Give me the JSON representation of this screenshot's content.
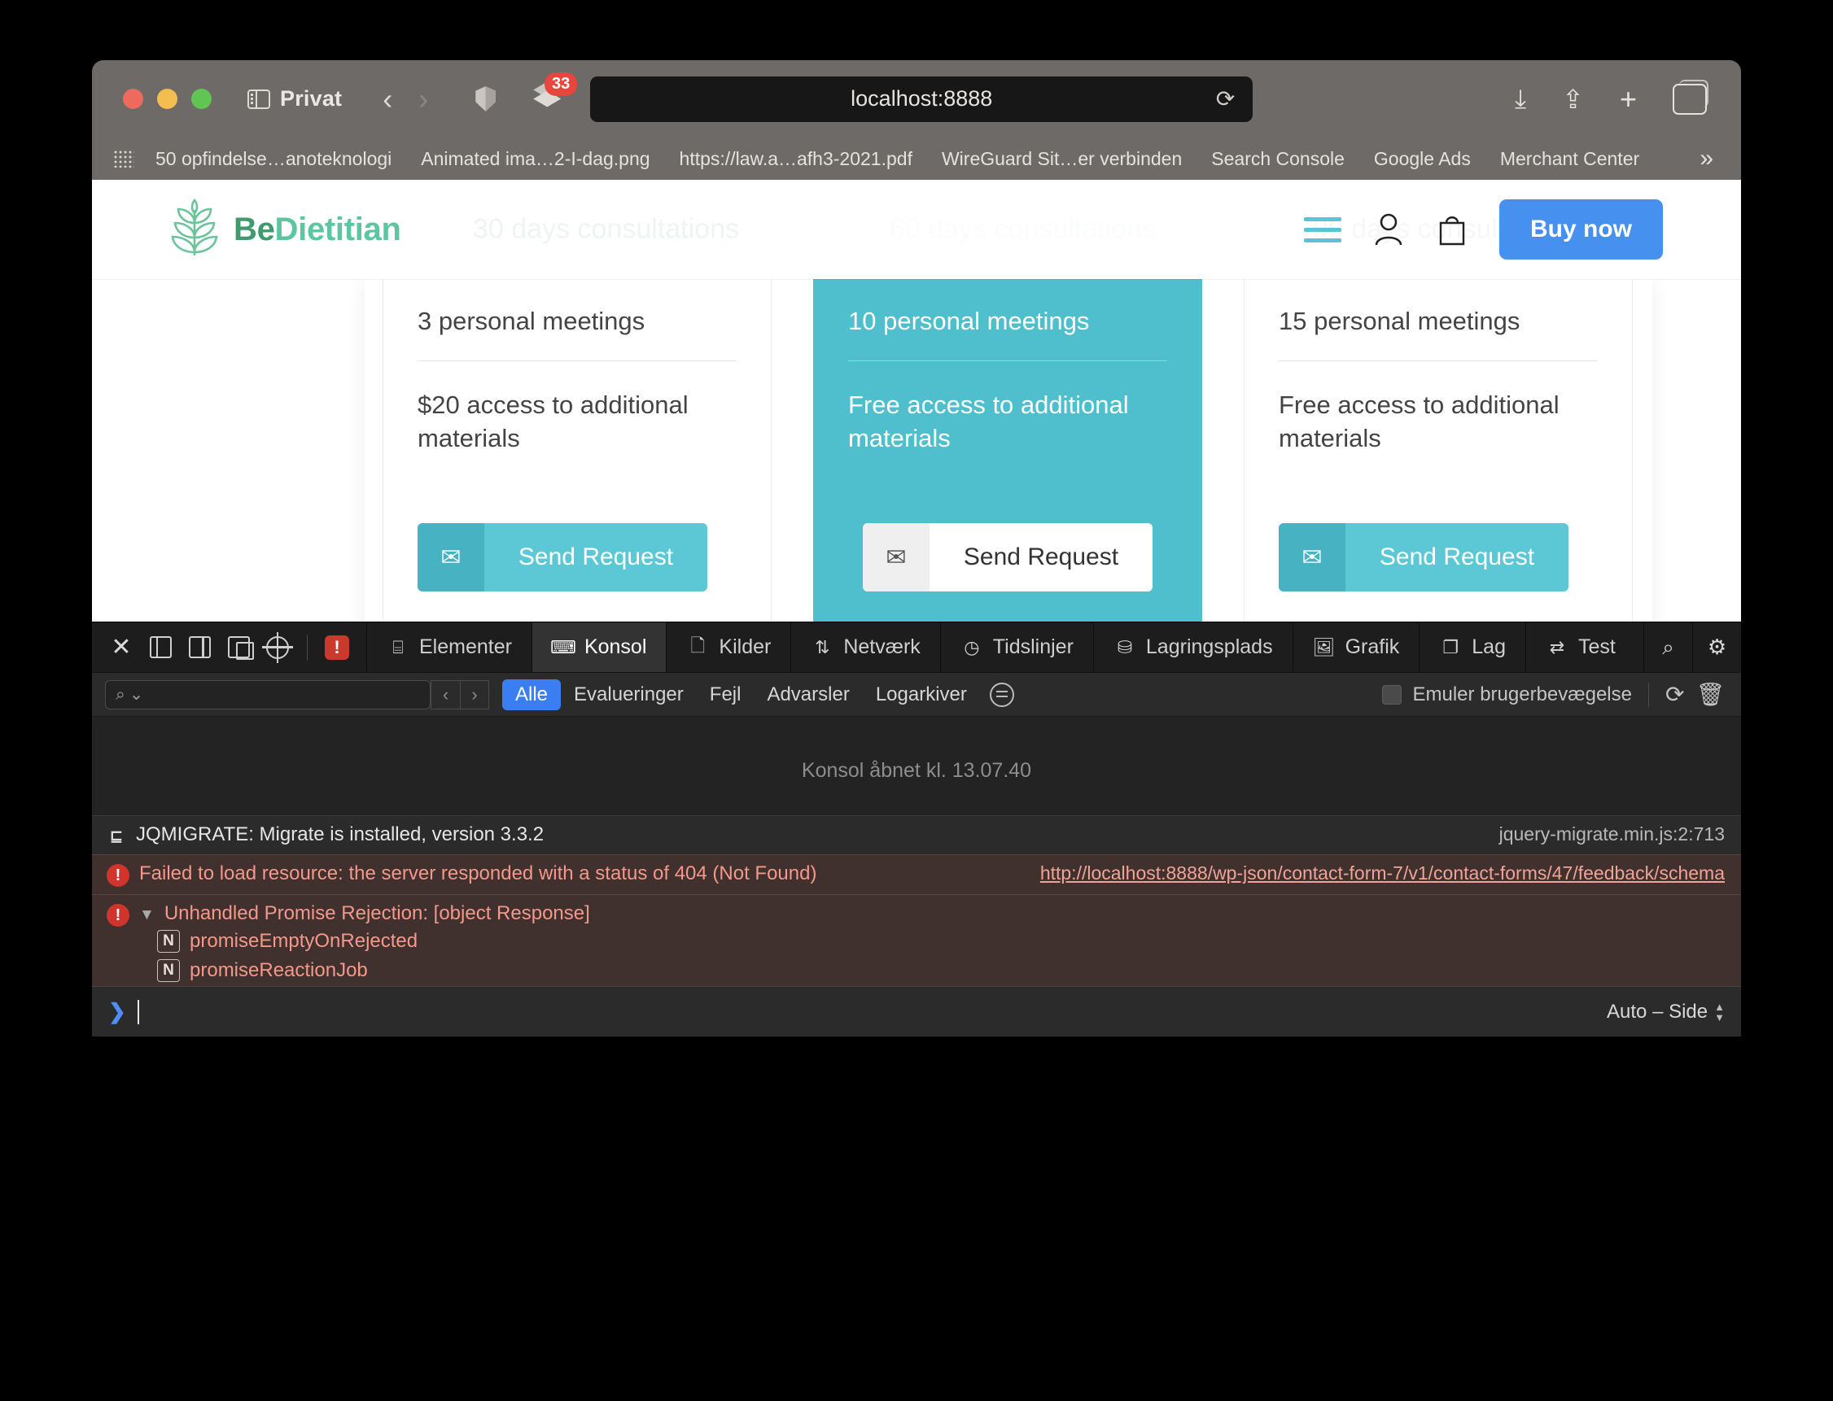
{
  "browser": {
    "window_label": "Privat",
    "url": "localhost:8888",
    "tab_badge": "33",
    "bookmarks": [
      "50 opfindelse…anoteknologi",
      "Animated ima…2-I-dag.png",
      "https://law.a…afh3-2021.pdf",
      "WireGuard Sit…er verbinden",
      "Search Console",
      "Google Ads",
      "Merchant Center"
    ],
    "overflow_label": "»"
  },
  "site": {
    "brand_part1": "Be",
    "brand_part2": "Dietitian",
    "buy_now": "Buy now",
    "ghost_headings": [
      "30 days consultations",
      "60 days consultations",
      "90 days consultations"
    ],
    "cards": [
      {
        "meetings": "3 personal meetings",
        "materials": "$20 access to additional materials",
        "button": "Send Request",
        "highlighted": false
      },
      {
        "meetings": "10 personal meetings",
        "materials": "Free access to additional materials",
        "button": "Send Request",
        "highlighted": true
      },
      {
        "meetings": "15 personal meetings",
        "materials": "Free access to additional materials",
        "button": "Send Request",
        "highlighted": false
      }
    ]
  },
  "devtools": {
    "tabs": [
      "Elementer",
      "Konsol",
      "Kilder",
      "Netværk",
      "Tidslinjer",
      "Lagringsplads",
      "Grafik",
      "Lag",
      "Test"
    ],
    "active_tab": "Konsol",
    "search_placeholder": "",
    "filters": [
      "Alle",
      "Evalueringer",
      "Fejl",
      "Advarsler",
      "Logarkiver"
    ],
    "active_filter": "Alle",
    "emulate_label": "Emuler brugerbevægelse",
    "console_opened": "Konsol åbnet kl. 13.07.40",
    "messages": [
      {
        "type": "info",
        "text": "JQMIGRATE: Migrate is installed, version 3.3.2",
        "source": "jquery-migrate.min.js:2:713"
      },
      {
        "type": "error",
        "text": "Failed to load resource: the server responded with a status of 404 (Not Found)",
        "source": "http://localhost:8888/wp-json/contact-form-7/v1/contact-forms/47/feedback/schema"
      }
    ],
    "rejection": {
      "title": "Unhandled Promise Rejection: [object Response]",
      "frames": [
        "promiseEmptyOnRejected",
        "promiseReactionJob"
      ]
    },
    "prompt_mode": "Auto – Side"
  },
  "colors": {
    "accent_teal": "#5cc8d6",
    "brand_green": "#3f9b6d",
    "buy_blue": "#4690ef",
    "filter_blue": "#3b7ef2",
    "error_red": "#d0342c"
  }
}
